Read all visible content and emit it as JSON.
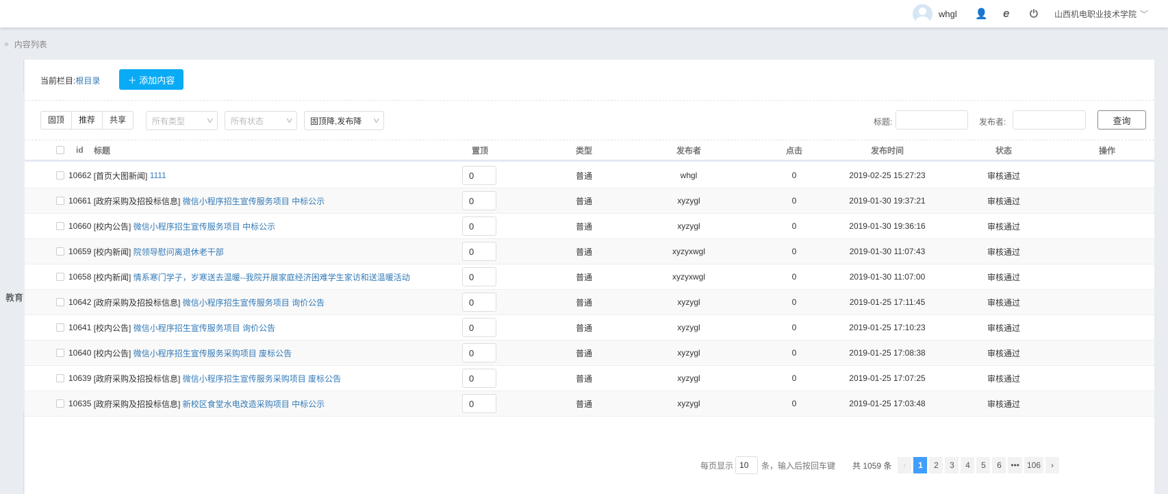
{
  "header": {
    "username": "whgl",
    "org": "山西机电职业技术学院",
    "icons": [
      "avatar",
      "user-edit-icon",
      "ie-browser-icon",
      "power-icon",
      "chevron-down-icon"
    ]
  },
  "breadcrumb": {
    "label": "内容列表"
  },
  "sidebar_fragment": "教育",
  "toolbar": {
    "current_label": "当前栏目:",
    "current_value": "根目录",
    "add_label": "＋ 添加内容"
  },
  "filters": {
    "toggles": [
      "固顶",
      "推荐",
      "共享"
    ],
    "type_placeholder": "所有类型",
    "status_placeholder": "所有状态",
    "sort_value": "固顶降,发布降",
    "title_label": "标题:",
    "publisher_label": "发布者:",
    "query_label": "查询"
  },
  "table": {
    "headers": {
      "id": "id",
      "title": "标题",
      "top": "置顶",
      "type": "类型",
      "publisher": "发布者",
      "clicks": "点击",
      "time": "发布时间",
      "status": "状态",
      "ops": "操作"
    },
    "rows": [
      {
        "id": "10662",
        "cat": "[首页大图新闻]",
        "title": "1111",
        "top": "0",
        "type": "普通",
        "publisher": "whgl",
        "clicks": "0",
        "time": "2019-02-25 15:27:23",
        "status": "审核通过"
      },
      {
        "id": "10661",
        "cat": "[政府采购及招投标信息]",
        "title": "微信小程序招生宣传服务项目 中标公示",
        "top": "0",
        "type": "普通",
        "publisher": "xyzygl",
        "clicks": "0",
        "time": "2019-01-30 19:37:21",
        "status": "审核通过"
      },
      {
        "id": "10660",
        "cat": "[校内公告]",
        "title": "微信小程序招生宣传服务项目 中标公示",
        "top": "0",
        "type": "普通",
        "publisher": "xyzygl",
        "clicks": "0",
        "time": "2019-01-30 19:36:16",
        "status": "审核通过"
      },
      {
        "id": "10659",
        "cat": "[校内新闻]",
        "title": "院领导慰问离退休老干部",
        "top": "0",
        "type": "普通",
        "publisher": "xyzyxwgl",
        "clicks": "0",
        "time": "2019-01-30 11:07:43",
        "status": "审核通过"
      },
      {
        "id": "10658",
        "cat": "[校内新闻]",
        "title": "情系寒门学子，岁寒送去温暖--我院开展家庭经济困难学生家访和送温暖活动",
        "top": "0",
        "type": "普通",
        "publisher": "xyzyxwgl",
        "clicks": "0",
        "time": "2019-01-30 11:07:00",
        "status": "审核通过"
      },
      {
        "id": "10642",
        "cat": "[政府采购及招投标信息]",
        "title": "微信小程序招生宣传服务项目 询价公告",
        "top": "0",
        "type": "普通",
        "publisher": "xyzygl",
        "clicks": "0",
        "time": "2019-01-25 17:11:45",
        "status": "审核通过"
      },
      {
        "id": "10641",
        "cat": "[校内公告]",
        "title": "微信小程序招生宣传服务项目 询价公告",
        "top": "0",
        "type": "普通",
        "publisher": "xyzygl",
        "clicks": "0",
        "time": "2019-01-25 17:10:23",
        "status": "审核通过"
      },
      {
        "id": "10640",
        "cat": "[校内公告]",
        "title": "微信小程序招生宣传服务采购项目 废标公告",
        "top": "0",
        "type": "普通",
        "publisher": "xyzygl",
        "clicks": "0",
        "time": "2019-01-25 17:08:38",
        "status": "审核通过"
      },
      {
        "id": "10639",
        "cat": "[政府采购及招投标信息]",
        "title": "微信小程序招生宣传服务采购项目 废标公告",
        "top": "0",
        "type": "普通",
        "publisher": "xyzygl",
        "clicks": "0",
        "time": "2019-01-25 17:07:25",
        "status": "审核通过"
      },
      {
        "id": "10635",
        "cat": "[政府采购及招投标信息]",
        "title": "新校区食堂水电改造采购项目 中标公示",
        "top": "0",
        "type": "普通",
        "publisher": "xyzygl",
        "clicks": "0",
        "time": "2019-01-25 17:03:48",
        "status": "审核通过"
      }
    ]
  },
  "pagination": {
    "per_page_label": "每页显示",
    "per_page": "10",
    "hint": "条，输入后按回车键",
    "total": "共 1059 条",
    "prev": "‹",
    "pages": [
      "1",
      "2",
      "3",
      "4",
      "5",
      "6",
      "•••",
      "106"
    ],
    "current": "1",
    "next": "›"
  }
}
